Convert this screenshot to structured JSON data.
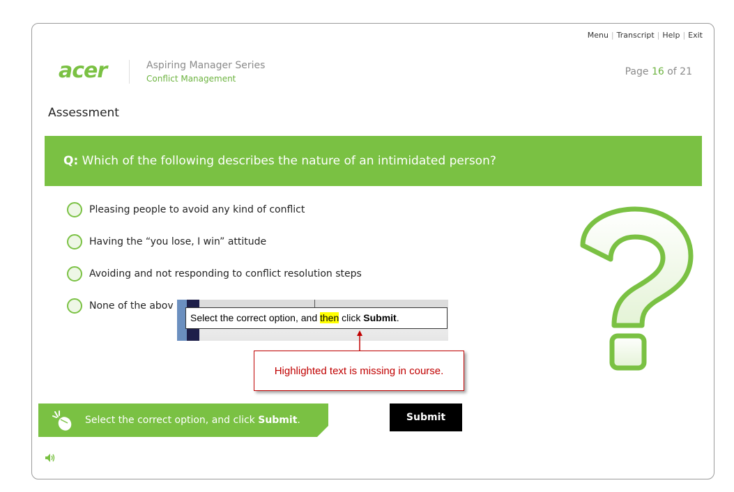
{
  "nav": {
    "menu": "Menu",
    "transcript": "Transcript",
    "help": "Help",
    "exit": "Exit",
    "separator": "|"
  },
  "header": {
    "logo_text": "acer",
    "series_title": "Aspiring Manager Series",
    "course_title": "Conflict Management",
    "page_prefix": "Page",
    "page_current": "16",
    "page_of": "of",
    "page_total": "21"
  },
  "section_title": "Assessment",
  "question": {
    "prefix": "Q:",
    "text": "Which of the following describes the nature of an intimidated person?"
  },
  "options": [
    {
      "label": "Pleasing people to avoid any kind of conflict"
    },
    {
      "label": "Having the “you lose, I win” attitude"
    },
    {
      "label": "Avoiding and not responding to conflict resolution steps"
    },
    {
      "label": "None of the abov"
    }
  ],
  "inset": {
    "text_before": "Select the correct option, and ",
    "text_highlight": "then",
    "text_mid": " click ",
    "text_bold": "Submit",
    "text_end": "."
  },
  "callout": {
    "text": "Highlighted text is missing in course."
  },
  "instruction": {
    "text": "Select the correct option, and click ",
    "bold": "Submit",
    "end": "."
  },
  "submit_label": "Submit",
  "colors": {
    "accent_green": "#7ac143",
    "callout_red": "#c00000",
    "highlight_yellow": "#ffff00"
  },
  "icons": {
    "instruction": "mouse-click-icon",
    "audio": "speaker-icon",
    "decoration": "question-mark-icon"
  }
}
